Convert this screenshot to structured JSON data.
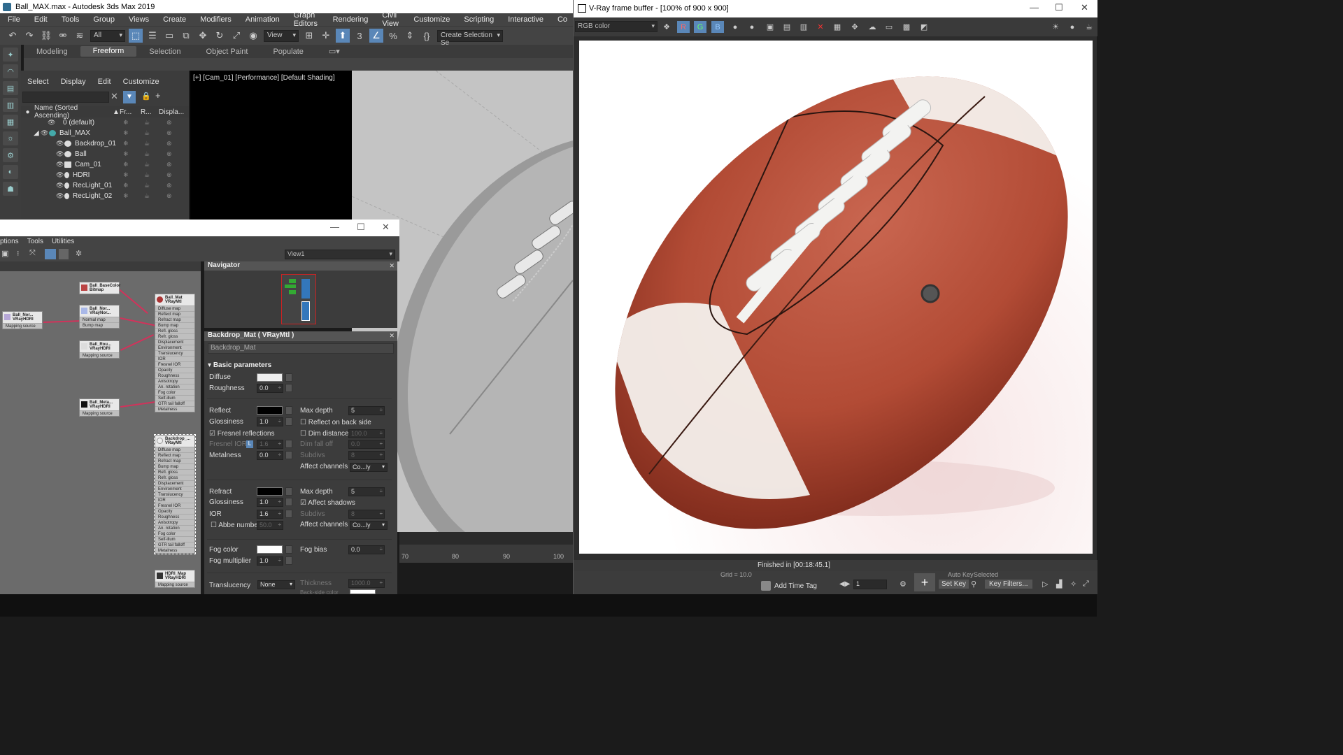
{
  "main_window": {
    "title": "Ball_MAX.max - Autodesk 3ds Max 2019",
    "menu": [
      "File",
      "Edit",
      "Tools",
      "Group",
      "Views",
      "Create",
      "Modifiers",
      "Animation",
      "Graph Editors",
      "Rendering",
      "Civil View",
      "Customize",
      "Scripting",
      "Interactive",
      "Co"
    ],
    "toolbar": {
      "selection_filter": "All",
      "ref_coord": "View",
      "named_selection": "Create Selection Se"
    },
    "ribbon_tabs": [
      "Modeling",
      "Freeform",
      "Selection",
      "Object Paint",
      "Populate"
    ],
    "ribbon_active": "Freeform"
  },
  "scene_explorer": {
    "menu": [
      "Select",
      "Display",
      "Edit",
      "Customize"
    ],
    "columns": {
      "name": "Name (Sorted Ascending)",
      "sort_arrow": "▲",
      "frozen": "Fr...",
      "renderable": "R...",
      "display": "Displa..."
    },
    "rows": [
      {
        "label": "0 (default)",
        "indent": 1
      },
      {
        "label": "Ball_MAX",
        "indent": 0
      },
      {
        "label": "Backdrop_01",
        "indent": 2
      },
      {
        "label": "Ball",
        "indent": 2
      },
      {
        "label": "Cam_01",
        "indent": 2
      },
      {
        "label": "HDRI",
        "indent": 2
      },
      {
        "label": "RecLight_01",
        "indent": 2
      },
      {
        "label": "RecLight_02",
        "indent": 2
      }
    ]
  },
  "viewport": {
    "label": "[+] [Cam_01] [Performance] [Default Shading]"
  },
  "timeline": {
    "ticks": [
      "70",
      "80",
      "90",
      "100"
    ]
  },
  "slate": {
    "menu": [
      "ptions",
      "Tools",
      "Utilities"
    ],
    "view_name": "View1",
    "nodes": [
      {
        "title": "Ball_BaseColor",
        "sub": "Bitmap"
      },
      {
        "title": "Ball_Nor...",
        "sub": "VRayNor...",
        "rows": [
          "Normal map",
          "Bump map"
        ]
      },
      {
        "title": "Ball_Nor...",
        "sub": "VRayHDRI",
        "rows": [
          "Mapping source"
        ]
      },
      {
        "title": "Ball_Rou...",
        "sub": "VRayHDRI",
        "rows": [
          "Mapping source"
        ]
      },
      {
        "title": "Ball_Meta...",
        "sub": "VRayHDRI",
        "rows": [
          "Mapping source"
        ]
      },
      {
        "title": "Ball_Mat",
        "sub": "VRayMtl"
      },
      {
        "title": "Backdrop_...",
        "sub": "VRayMtl"
      },
      {
        "title": "HDRI_Map",
        "sub": "VRayHDRI",
        "rows": [
          "Mapping source"
        ]
      }
    ],
    "mtl_slots": [
      "Diffuse map",
      "Reflect map",
      "Refract map",
      "Bump map",
      "Refl. gloss",
      "Refr. gloss",
      "Displacement",
      "Environment",
      "Translucency",
      "IOR",
      "Fresnel IOR",
      "Opacity",
      "Roughness",
      "Anisotropy",
      "An. rotation",
      "Fog color",
      "Self-illum",
      "GTR tail falloff",
      "Metalness"
    ]
  },
  "navigator": {
    "title": "Navigator"
  },
  "params": {
    "header": "Backdrop_Mat  ( VRayMtl )",
    "name": "Backdrop_Mat",
    "rollout": "Basic parameters",
    "diffuse_label": "Diffuse",
    "roughness_label": "Roughness",
    "roughness": "0.0",
    "reflect_label": "Reflect",
    "gloss_label": "Glossiness",
    "gloss": "1.0",
    "fresnel_label": "Fresnel reflections",
    "fresnel_ior_label": "Fresnel IOR",
    "fresnel_ior": "1.6",
    "l_badge": "L",
    "metalness_label": "Metalness",
    "metalness": "0.0",
    "maxdepth_label": "Max depth",
    "maxdepth": "5",
    "backside_label": "Reflect on back side",
    "dimdist_label": "Dim distance",
    "dimdist": "100.0",
    "dimfall_label": "Dim fall off",
    "dimfall": "0.0",
    "subdivs_label": "Subdivs",
    "subdivs": "8",
    "affect_label": "Affect channels",
    "affect": "Co...ly",
    "refract_label": "Refract",
    "rgloss": "1.0",
    "ior_label": "IOR",
    "ior": "1.6",
    "abbe_label": "Abbe number",
    "abbe": "50.0",
    "rmaxdepth": "5",
    "shadows_label": "Affect shadows",
    "rsubdivs": "8",
    "raffect": "Co...ly",
    "fogcolor_label": "Fog color",
    "fogbias_label": "Fog bias",
    "fogbias": "0.0",
    "fogmult_label": "Fog multiplier",
    "fogmult": "1.0",
    "transl_label": "Translucency",
    "transl": "None",
    "thick_label": "Thickness",
    "thick": "1000.0",
    "backside_color_label": "Back-side color"
  },
  "vfb": {
    "title": "V-Ray frame buffer - [100% of 900 x 900]",
    "channel": "RGB color",
    "status": "Finished in [00:18:45.1]",
    "bottom": {
      "add_time_tag": "Add Time Tag",
      "set_key": "Set Key",
      "key_filters": "Key Filters...",
      "frame": "1",
      "auto_key": "Auto Key",
      "selected": "Selected",
      "grid": "Grid = 10.0"
    }
  },
  "colors": {
    "accent": "#5a87b8",
    "ball": "#b8503b",
    "stripe": "#f4f0ec",
    "wire": "#d1335b"
  }
}
